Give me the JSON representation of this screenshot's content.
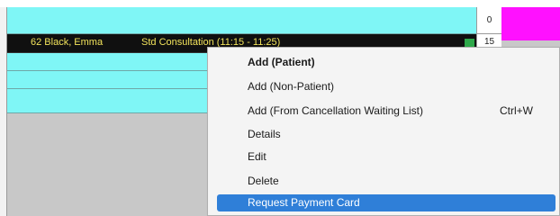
{
  "schedule": {
    "appointment": {
      "patient": "62 Black, Emma",
      "type_and_time": "Std Consultation (11:15 - 11:25)"
    },
    "time_labels": [
      "0",
      "15"
    ]
  },
  "context_menu": {
    "items": [
      {
        "label": "Add (Patient)",
        "shortcut": ""
      },
      {
        "label": "Add (Non-Patient)",
        "shortcut": ""
      },
      {
        "label": "Add (From Cancellation Waiting List)",
        "shortcut": "Ctrl+W"
      },
      {
        "label": "Details",
        "shortcut": ""
      },
      {
        "label": "Edit",
        "shortcut": ""
      },
      {
        "label": "Delete",
        "shortcut": ""
      },
      {
        "label": "Request Payment Card",
        "shortcut": ""
      }
    ],
    "default_item_index": 0,
    "highlighted_item_index": 6
  },
  "colors": {
    "free_slot": "#7ff6f6",
    "booked_slot": "#101010",
    "booked_text": "#f2e35b",
    "status_marker": "#2ea84a",
    "other_column": "#ff11ff",
    "menu_highlight": "#2f7fd8"
  }
}
